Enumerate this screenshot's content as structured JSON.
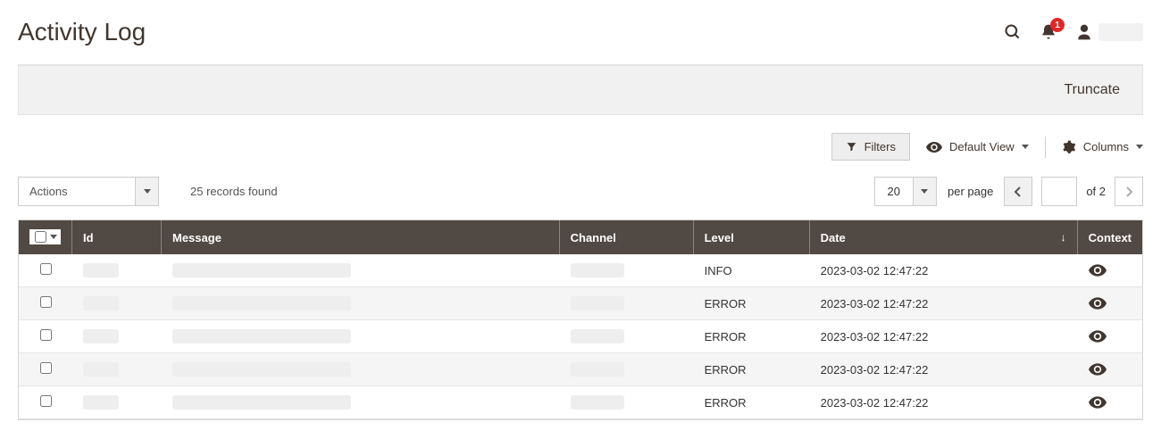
{
  "header": {
    "title": "Activity Log",
    "notification_count": "1"
  },
  "truncate": {
    "label": "Truncate"
  },
  "toolbar": {
    "filters_label": "Filters",
    "view_label": "Default View",
    "columns_label": "Columns"
  },
  "actions": {
    "label": "Actions"
  },
  "records": {
    "text": "25 records found"
  },
  "pager": {
    "per_page_value": "20",
    "per_page_label": "per page",
    "page_value": "",
    "of_label": "of 2"
  },
  "table": {
    "headers": {
      "id": "Id",
      "message": "Message",
      "channel": "Channel",
      "level": "Level",
      "date": "Date",
      "context": "Context"
    },
    "rows": [
      {
        "level": "INFO",
        "date": "2023-03-02 12:47:22"
      },
      {
        "level": "ERROR",
        "date": "2023-03-02 12:47:22"
      },
      {
        "level": "ERROR",
        "date": "2023-03-02 12:47:22"
      },
      {
        "level": "ERROR",
        "date": "2023-03-02 12:47:22"
      },
      {
        "level": "ERROR",
        "date": "2023-03-02 12:47:22"
      }
    ]
  }
}
